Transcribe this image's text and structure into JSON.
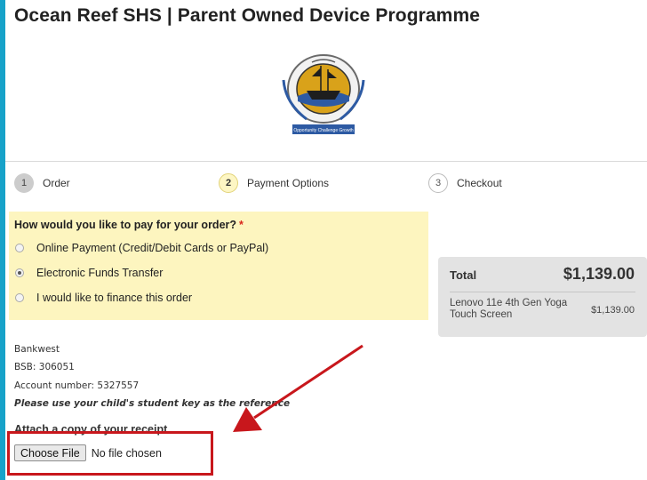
{
  "header": {
    "title": "Ocean Reef SHS | Parent Owned Device Programme"
  },
  "logo": {
    "banner_text": "Opportunity Challenge Growth",
    "ring_text": "OCEAN REEF SENIOR HIGH SCHOOL"
  },
  "steps": [
    {
      "number": "1",
      "label": "Order"
    },
    {
      "number": "2",
      "label": "Payment Options"
    },
    {
      "number": "3",
      "label": "Checkout"
    }
  ],
  "payment": {
    "question": "How would you like to pay for your order?",
    "required_mark": "*",
    "options": [
      "Online Payment (Credit/Debit Cards or PayPal)",
      "Electronic Funds Transfer",
      "I would like to finance this order"
    ],
    "selected": "Electronic Funds Transfer"
  },
  "summary": {
    "total_label": "Total",
    "total_value": "$1,139.00",
    "item_name": "Lenovo 11e 4th Gen Yoga Touch Screen",
    "item_price": "$1,139.00"
  },
  "bank_details": {
    "bank": "Bankwest",
    "bsb": "BSB: 306051",
    "account": "Account number: 5327557",
    "note": "Please use your child's student key as the reference"
  },
  "upload": {
    "label": "Attach a copy of your receipt",
    "button": "Choose File",
    "status": "No file chosen"
  },
  "colors": {
    "frame": "#17a2c9",
    "highlight": "#c8171c",
    "pay_panel": "#fdf5bf"
  }
}
